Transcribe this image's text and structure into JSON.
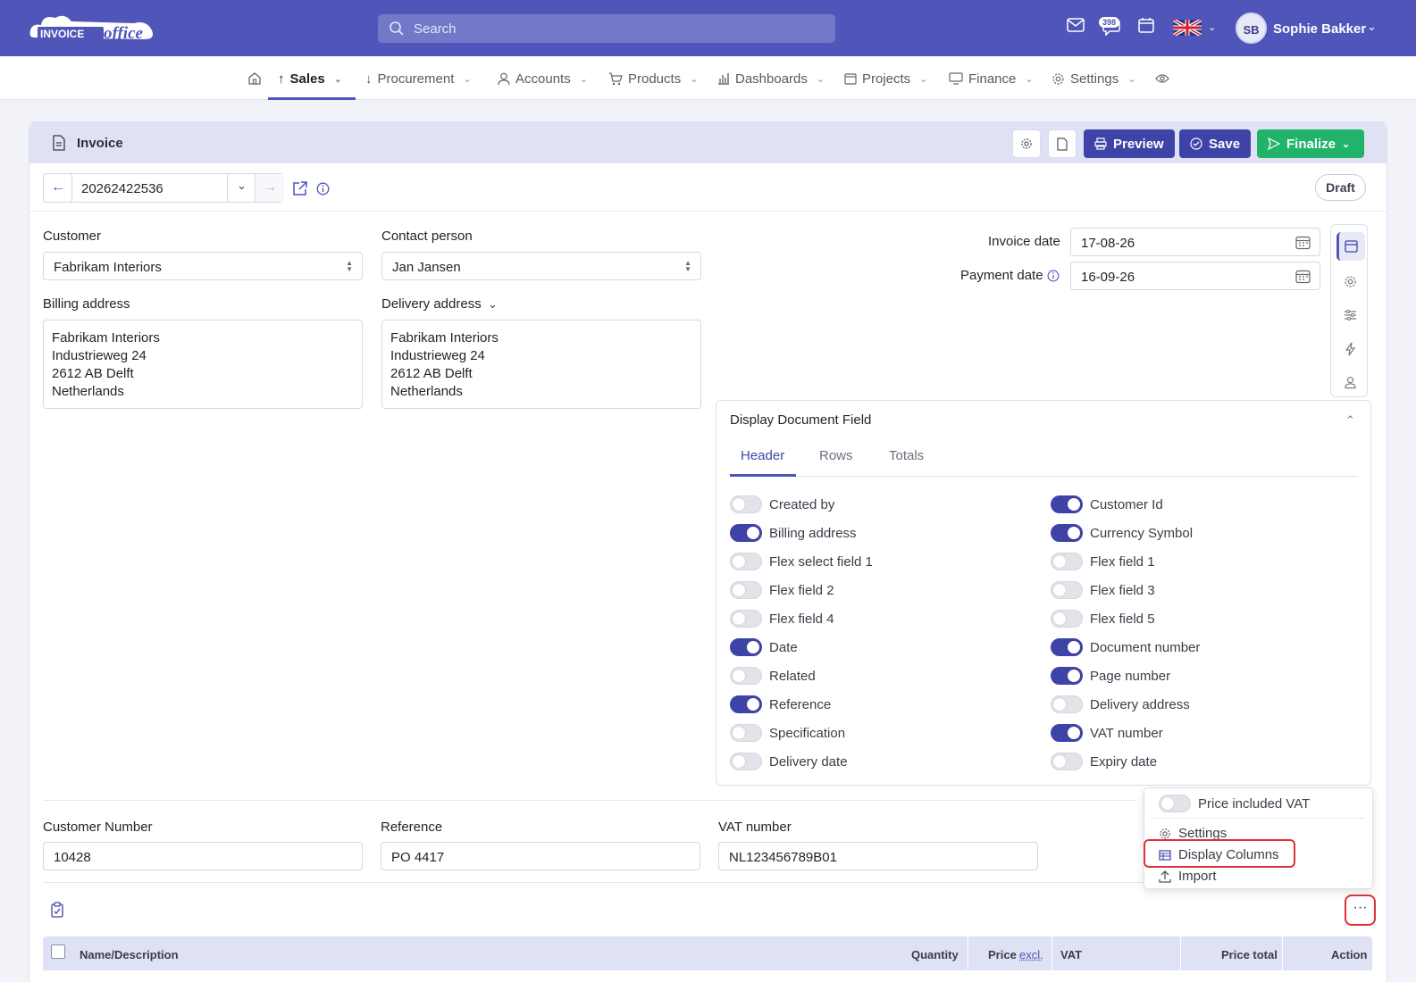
{
  "topbar": {
    "logo_text": "INVOICEoffice",
    "search_placeholder": "Search",
    "notification_count": "398",
    "user_initials": "SB",
    "user_name": "Sophie Bakker"
  },
  "nav": {
    "items": [
      {
        "label": "Sales"
      },
      {
        "label": "Procurement"
      },
      {
        "label": "Accounts"
      },
      {
        "label": "Products"
      },
      {
        "label": "Dashboards"
      },
      {
        "label": "Projects"
      },
      {
        "label": "Finance"
      },
      {
        "label": "Settings"
      }
    ]
  },
  "card": {
    "title": "Invoice",
    "preview_label": "Preview",
    "save_label": "Save",
    "finalize_label": "Finalize",
    "document_number": "20262422536",
    "status": "Draft"
  },
  "form": {
    "customer_label": "Customer",
    "customer_value": "Fabrikam Interiors",
    "contact_label": "Contact person",
    "contact_value": "Jan Jansen",
    "billing_label": "Billing address",
    "billing_lines": [
      "Fabrikam Interiors",
      "Industrieweg 24",
      "2612 AB Delft",
      "Netherlands"
    ],
    "delivery_label": "Delivery address",
    "delivery_lines": [
      "Fabrikam Interiors",
      "Industrieweg 24",
      "2612 AB Delft",
      "Netherlands"
    ],
    "invoice_date_label": "Invoice date",
    "invoice_date_value": "17-08-26",
    "payment_date_label": "Payment date",
    "payment_date_value": "16-09-26",
    "customer_number_label": "Customer Number",
    "customer_number_value": "10428",
    "reference_label": "Reference",
    "reference_value": "PO 4417",
    "vat_label": "VAT number",
    "vat_value": "NL123456789B01"
  },
  "display_fields": {
    "title": "Display Document Field",
    "tabs": [
      "Header",
      "Rows",
      "Totals"
    ],
    "left": [
      {
        "label": "Created by",
        "on": false
      },
      {
        "label": "Billing address",
        "on": true
      },
      {
        "label": "Flex select field 1",
        "on": false
      },
      {
        "label": "Flex field 2",
        "on": false
      },
      {
        "label": "Flex field 4",
        "on": false
      },
      {
        "label": "Date",
        "on": true
      },
      {
        "label": "Related",
        "on": false
      },
      {
        "label": "Reference",
        "on": true
      },
      {
        "label": "Specification",
        "on": false
      },
      {
        "label": "Delivery date",
        "on": false
      }
    ],
    "right": [
      {
        "label": "Customer Id",
        "on": true
      },
      {
        "label": "Currency Symbol",
        "on": true
      },
      {
        "label": "Flex field 1",
        "on": false
      },
      {
        "label": "Flex field 3",
        "on": false
      },
      {
        "label": "Flex field 5",
        "on": false
      },
      {
        "label": "Document number",
        "on": true
      },
      {
        "label": "Page number",
        "on": true
      },
      {
        "label": "Delivery address",
        "on": false
      },
      {
        "label": "VAT number",
        "on": true
      },
      {
        "label": "Expiry date",
        "on": false
      }
    ]
  },
  "menu": {
    "price_vat_label": "Price included VAT",
    "price_vat_on": false,
    "settings_label": "Settings",
    "display_columns_label": "Display Columns",
    "import_label": "Import",
    "more_label": "···"
  },
  "table": {
    "headers": {
      "name": "Name/Description",
      "quantity": "Quantity",
      "price": "Price",
      "price_suffix": "excl.",
      "vat": "VAT",
      "price_total": "Price total",
      "action": "Action"
    }
  },
  "colors": {
    "brand": "#4f55b9",
    "primary_button": "#3e43a8",
    "finalize": "#21b36a",
    "highlight": "#e0303a"
  }
}
